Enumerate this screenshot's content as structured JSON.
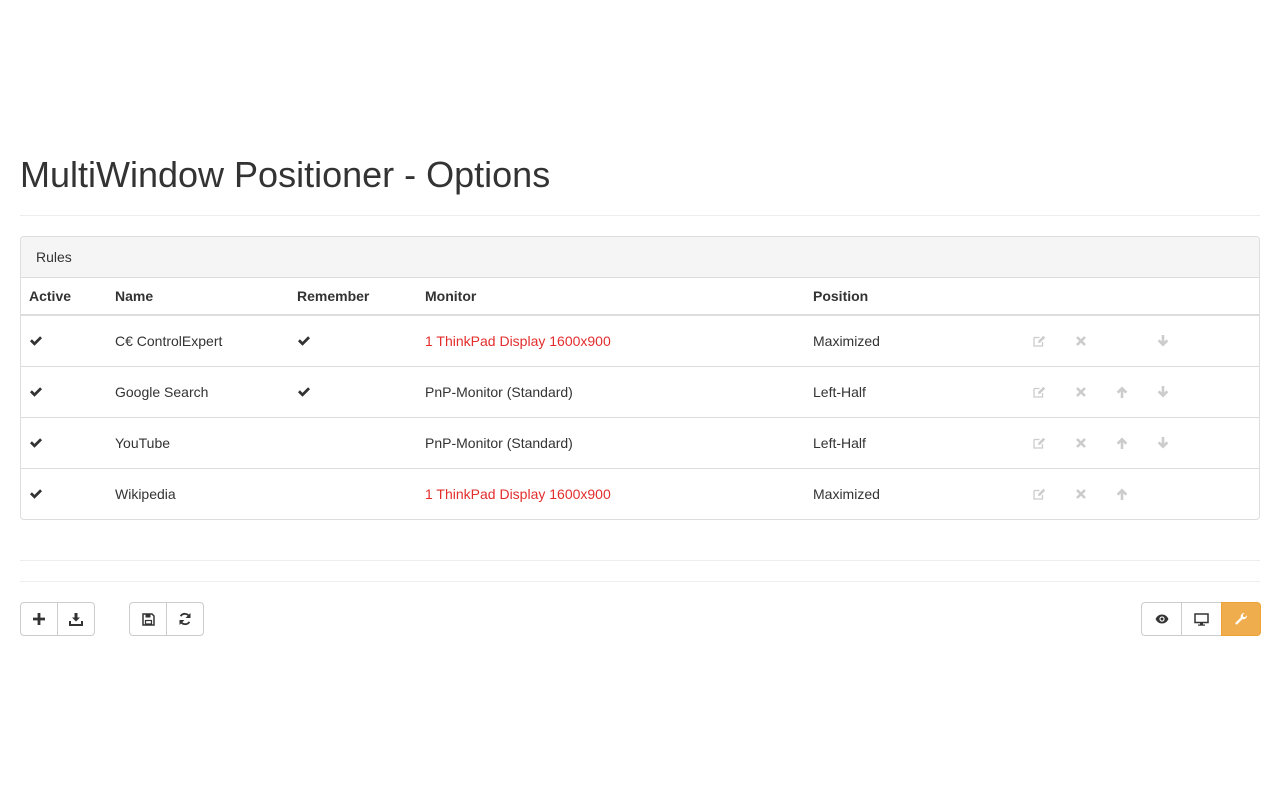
{
  "page": {
    "title": "MultiWindow Positioner - Options"
  },
  "panel": {
    "heading": "Rules"
  },
  "table": {
    "columns": {
      "active": "Active",
      "name": "Name",
      "remember": "Remember",
      "monitor": "Monitor",
      "position": "Position"
    },
    "rows": [
      {
        "active": true,
        "name": "C€ ControlExpert",
        "remember": true,
        "monitor": "1 ThinkPad Display 1600x900",
        "monitor_warning": true,
        "position": "Maximized",
        "has_up": false,
        "has_down": true
      },
      {
        "active": true,
        "name": "Google Search",
        "remember": true,
        "monitor": "PnP-Monitor (Standard)",
        "monitor_warning": false,
        "position": "Left-Half",
        "has_up": true,
        "has_down": true
      },
      {
        "active": true,
        "name": "YouTube",
        "remember": false,
        "monitor": "PnP-Monitor (Standard)",
        "monitor_warning": false,
        "position": "Left-Half",
        "has_up": true,
        "has_down": true
      },
      {
        "active": true,
        "name": "Wikipedia",
        "remember": false,
        "monitor": "1 ThinkPad Display 1600x900",
        "monitor_warning": true,
        "position": "Maximized",
        "has_up": true,
        "has_down": false
      }
    ]
  },
  "icons": {
    "check": "check-icon",
    "edit": "edit-icon",
    "delete": "delete-icon",
    "move_up": "arrow-up-icon",
    "move_down": "arrow-down-icon",
    "add": "plus-icon",
    "import": "download-icon",
    "save": "floppy-disk-icon",
    "reload": "refresh-icon",
    "preview": "eye-icon",
    "monitors": "monitor-icon",
    "settings": "wrench-icon"
  },
  "colors": {
    "warning_text": "#e32d2d",
    "accent_button": "#f0ad4e",
    "disabled_icon": "#cccccc"
  }
}
